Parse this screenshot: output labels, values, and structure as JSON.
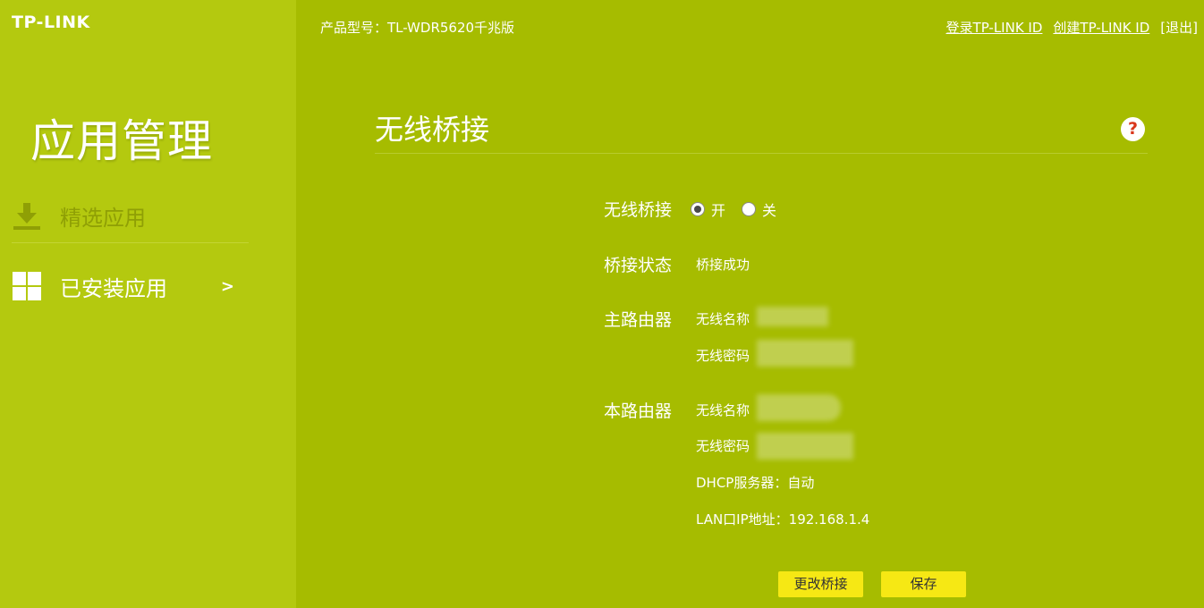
{
  "brand": "TP-LINK",
  "header": {
    "model_text": "产品型号：TL-WDR5620千兆版",
    "login_link": "登录TP-LINK ID",
    "create_link": "创建TP-LINK ID",
    "logout": "[退出]"
  },
  "sidebar": {
    "title": "应用管理",
    "items": [
      {
        "label": "精选应用",
        "icon": "download-icon"
      },
      {
        "label": "已安装应用",
        "icon": "grid-icon",
        "arrow": ">"
      }
    ]
  },
  "main": {
    "title": "无线桥接",
    "help": "?",
    "bridge": {
      "label": "无线桥接",
      "options": [
        {
          "label": "开",
          "checked": true
        },
        {
          "label": "关",
          "checked": false
        }
      ]
    },
    "status": {
      "label": "桥接状态",
      "value": "桥接成功"
    },
    "main_router": {
      "label": "主路由器",
      "ssid_label": "无线名称",
      "password_label": "无线密码"
    },
    "local_router": {
      "label": "本路由器",
      "ssid_label": "无线名称",
      "password_label": "无线密码",
      "dhcp": "DHCP服务器：自动",
      "lan_ip": "LAN口IP地址：192.168.1.4"
    },
    "buttons": {
      "change": "更改桥接",
      "save": "保存"
    }
  },
  "colors": {
    "main_bg": "#a6bc00",
    "sidebar_bg": "#b4c90f",
    "button_bg": "#f6e814"
  }
}
